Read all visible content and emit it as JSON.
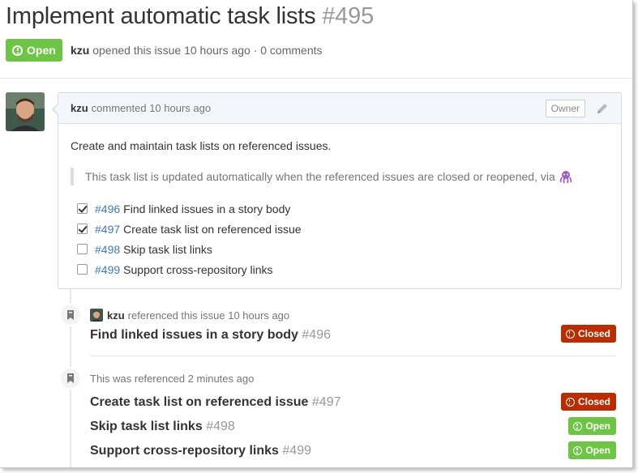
{
  "issue": {
    "title": "Implement automatic task lists",
    "number": "#495",
    "state": "Open",
    "author": "kzu",
    "meta_text": "opened this issue 10 hours ago · 0 comments"
  },
  "comment": {
    "author": "kzu",
    "header_text": "commented 10 hours ago",
    "owner_label": "Owner",
    "body_text": "Create and maintain task lists on referenced issues.",
    "quote_text": "This task list is updated automatically when the referenced issues are closed or reopened, via",
    "tasks": [
      {
        "number": "#496",
        "text": "Find linked issues in a story body",
        "checked": true
      },
      {
        "number": "#497",
        "text": "Create task list on referenced issue",
        "checked": true
      },
      {
        "number": "#498",
        "text": "Skip task list links",
        "checked": false
      },
      {
        "number": "#499",
        "text": "Support cross-repository links",
        "checked": false
      }
    ]
  },
  "events": {
    "first": {
      "author": "kzu",
      "text": "referenced this issue 10 hours ago",
      "ref_title": "Find linked issues in a story body",
      "ref_number": "#496",
      "state": "Closed"
    },
    "second": {
      "text": "This was referenced 2 minutes ago",
      "refs": [
        {
          "title": "Create task list on referenced issue",
          "number": "#497",
          "state": "Closed"
        },
        {
          "title": "Skip task list links",
          "number": "#498",
          "state": "Open"
        },
        {
          "title": "Support cross-repository links",
          "number": "#499",
          "state": "Open"
        }
      ]
    }
  },
  "colors": {
    "open": "#6cc644",
    "closed": "#bd2c00",
    "link": "#4078c0"
  },
  "icons": {
    "state": "issue-opened-icon",
    "edit": "pencil-icon",
    "event": "bookmark-icon",
    "emoji": "octocat-icon"
  }
}
